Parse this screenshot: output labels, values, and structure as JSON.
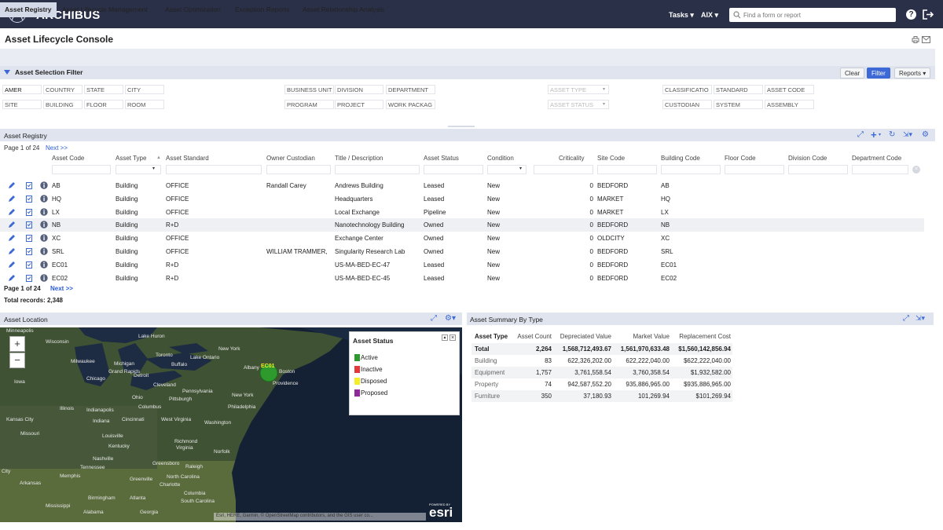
{
  "app": {
    "brand": "ARCHIBUS",
    "tasks": "Tasks ▾",
    "user": "AIX ▾",
    "search_placeholder": "Find a form or report"
  },
  "page": {
    "title": "Asset Lifecycle Console"
  },
  "tabs": [
    "Asset Registry",
    "Asset Lifecycle Management",
    "Asset Optimization",
    "Exception Reports",
    "Asset Relationship Analysis"
  ],
  "filter": {
    "title": "Asset Selection Filter",
    "clear": "Clear",
    "filter": "Filter",
    "reports": "Reports ▾",
    "row1": [
      "AMER",
      "COUNTRY",
      "STATE",
      "CITY",
      "BUSINESS UNIT",
      "DIVISION",
      "DEPARTMENT",
      "ASSET TYPE",
      "CLASSIFICATIO",
      "STANDARD",
      "ASSET CODE"
    ],
    "row2": [
      "SITE",
      "BUILDING",
      "FLOOR",
      "ROOM",
      "PROGRAM",
      "PROJECT",
      "WORK PACKAG",
      "ASSET STATUS",
      "CUSTODIAN",
      "SYSTEM",
      "ASSEMBLY"
    ]
  },
  "registry": {
    "title": "Asset Registry",
    "page_info": "Page 1 of 24",
    "next": "Next >>",
    "page_info_bottom": "Page 1 of 24",
    "next_bottom": "Next >>",
    "total": "Total records: 2,348",
    "columns": [
      "Asset Code",
      "Asset Type",
      "Asset Standard",
      "Owner Custodian",
      "Title / Description",
      "Asset Status",
      "Condition",
      "Criticality",
      "Site Code",
      "Building Code",
      "Floor Code",
      "Division Code",
      "Department Code"
    ],
    "rows": [
      [
        "AB",
        "Building",
        "OFFICE",
        "Randall Carey",
        "Andrews Building",
        "Leased",
        "New",
        "0",
        "BEDFORD",
        "AB"
      ],
      [
        "HQ",
        "Building",
        "OFFICE",
        "",
        "Headquarters",
        "Leased",
        "New",
        "0",
        "MARKET",
        "HQ"
      ],
      [
        "LX",
        "Building",
        "OFFICE",
        "",
        "Local Exchange",
        "Pipeline",
        "New",
        "0",
        "MARKET",
        "LX"
      ],
      [
        "NB",
        "Building",
        "R+D",
        "",
        "Nanotechnology Building",
        "Owned",
        "New",
        "0",
        "BEDFORD",
        "NB"
      ],
      [
        "XC",
        "Building",
        "OFFICE",
        "",
        "Exchange Center",
        "Owned",
        "New",
        "0",
        "OLDCITY",
        "XC"
      ],
      [
        "SRL",
        "Building",
        "OFFICE",
        "WILLIAM TRAMMER,",
        "Singularity Research Lab",
        "Owned",
        "New",
        "0",
        "BEDFORD",
        "SRL"
      ],
      [
        "EC01",
        "Building",
        "R+D",
        "",
        "US-MA-BED-EC-47",
        "Leased",
        "New",
        "0",
        "BEDFORD",
        "EC01"
      ],
      [
        "EC02",
        "Building",
        "R+D",
        "",
        "US-MA-BED-EC-45",
        "Leased",
        "New",
        "0",
        "BEDFORD",
        "EC02"
      ]
    ]
  },
  "map": {
    "title": "Asset Location",
    "legend_title": "Asset Status",
    "legend": [
      {
        "label": "Active",
        "color": "#2e9a2e"
      },
      {
        "label": "Inactive",
        "color": "#e23a3a"
      },
      {
        "label": "Disposed",
        "color": "#f4ee2a"
      },
      {
        "label": "Proposed",
        "color": "#8e2a9a"
      }
    ],
    "marker_label": "EC01",
    "attribution": "Esri, HERE, Garmin, © OpenStreetMap contributors, and the GIS user co...",
    "esri_small": "POWERED BY",
    "esri": "esri",
    "labels": [
      "Minneapolis",
      "Wisconsin",
      "Milwaukee",
      "Michigan",
      "Grand Rapids",
      "Toronto",
      "Buffalo",
      "Lake Ontario",
      "New York",
      "Albany",
      "Boston",
      "Providence",
      "Chicago",
      "Detroit",
      "Cleveland",
      "Pennsylvania",
      "Iowa",
      "Illinois",
      "Indiana",
      "Ohio",
      "Columbus",
      "Pittsburgh",
      "Philadelphia",
      "New York",
      "Indianapolis",
      "Cincinnati",
      "West Virginia",
      "Washington",
      "Kansas City",
      "Missouri",
      "Kentucky",
      "Virginia",
      "Richmond",
      "Louisville",
      "Norfolk",
      "Nashville",
      "Tennessee",
      "Greensboro",
      "Raleigh",
      "North Carolina",
      "Charlotte",
      "Memphis",
      "Greenville",
      "Arkansas",
      "Birmingham",
      "Atlanta",
      "Alabama",
      "Georgia",
      "Columbia",
      "South Carolina",
      "City",
      "Lake Huron",
      "Mississippi"
    ]
  },
  "summary": {
    "title": "Asset Summary By Type",
    "columns": [
      "Asset Type",
      "Asset Count",
      "Depreciated Value",
      "Market Value",
      "Replacement Cost"
    ],
    "rows": [
      [
        "Total",
        "2,264",
        "1,568,712,493.67",
        "1,561,970,633.48",
        "$1,560,142,856.94"
      ],
      [
        "Building",
        "83",
        "622,326,202.00",
        "622,222,040.00",
        "$622,222,040.00"
      ],
      [
        "Equipment",
        "1,757",
        "3,761,558.54",
        "3,760,358.54",
        "$1,932,582.00"
      ],
      [
        "Property",
        "74",
        "942,587,552.20",
        "935,886,965.00",
        "$935,886,965.00"
      ],
      [
        "Furniture",
        "350",
        "37,180.93",
        "101,269.94",
        "$101,269.94"
      ]
    ]
  }
}
